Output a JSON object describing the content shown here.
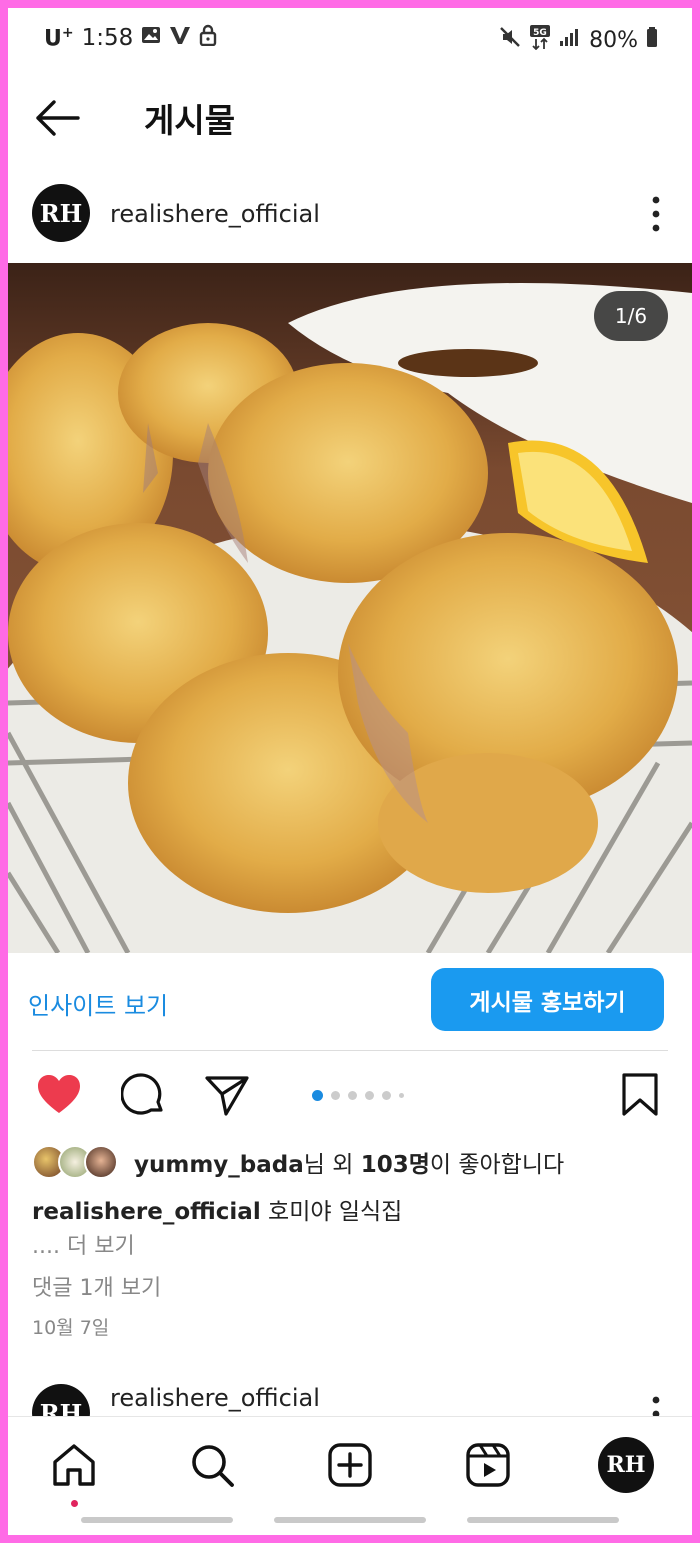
{
  "status_bar": {
    "carrier": "U",
    "carrier_sup": "+",
    "time": "1:58",
    "battery": "80%",
    "network": "5G"
  },
  "header": {
    "title": "게시물"
  },
  "post": {
    "username": "realishere_official",
    "avatar_text": "RH",
    "image_counter": "1/6",
    "insights_label": "인사이트 보기",
    "promote_label": "게시물 홍보하기",
    "carousel": {
      "total_dots": 6,
      "active_index": 0
    },
    "likes": {
      "user": "yummy_bada",
      "suffix1": "님 외 ",
      "count": "103명",
      "suffix2": "이 좋아합니다"
    },
    "caption_user": "realishere_official",
    "caption_text": " 호미야 일식집",
    "more_label": ".... 더 보기",
    "comments_label": "댓글 1개 보기",
    "date": "10월 7일"
  },
  "next_post": {
    "username": "realishere_official",
    "avatar_text": "RH"
  },
  "bottom_nav": {
    "items": [
      "home-icon",
      "search-icon",
      "create-icon",
      "reels-icon",
      "profile-avatar"
    ],
    "profile_avatar_text": "RH"
  },
  "colors": {
    "accent": "#1a9af0",
    "link": "#1a8be0",
    "like": "#ed3b4e",
    "frame": "#ff6be6"
  }
}
